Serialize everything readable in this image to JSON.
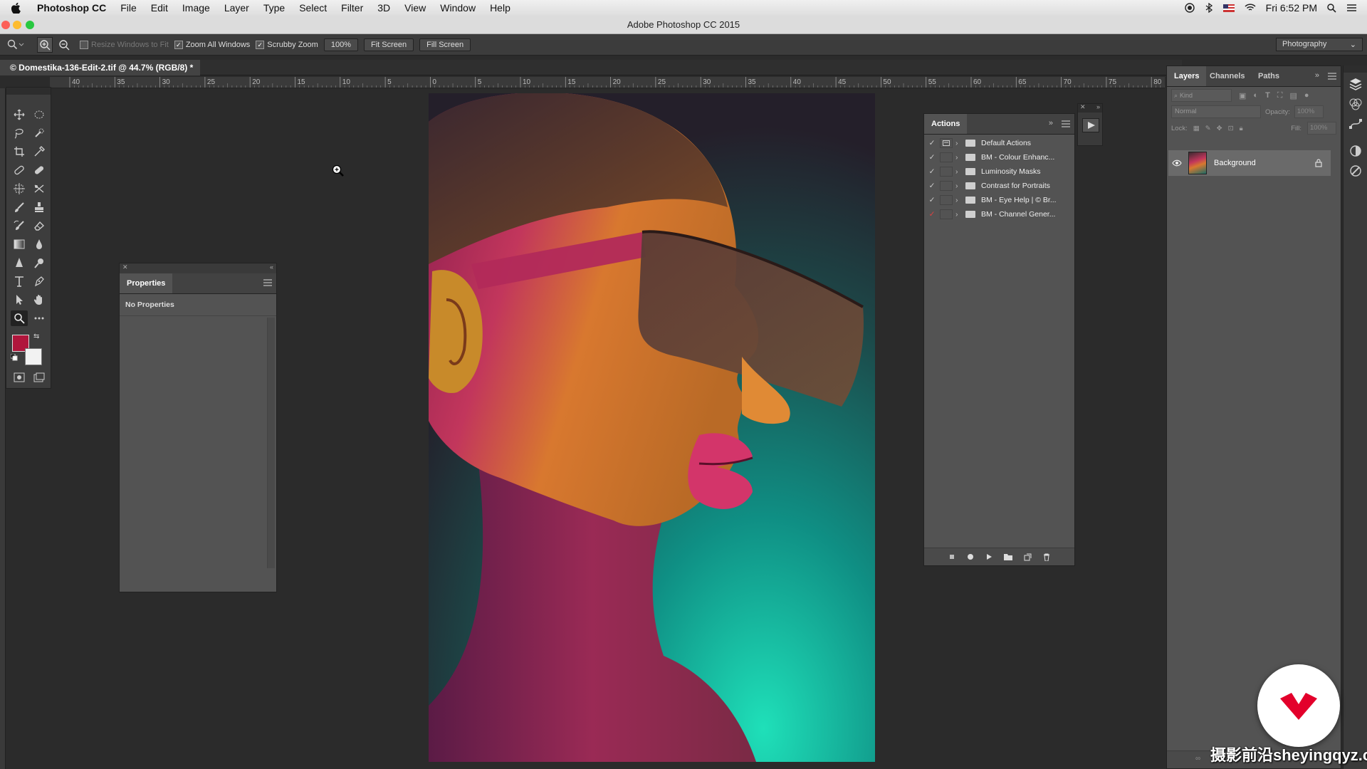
{
  "menubar": {
    "app_name": "Photoshop CC",
    "items": [
      "File",
      "Edit",
      "Image",
      "Layer",
      "Type",
      "Select",
      "Filter",
      "3D",
      "View",
      "Window",
      "Help"
    ],
    "clock": "Fri 6:52 PM"
  },
  "window": {
    "title": "Adobe Photoshop CC 2015"
  },
  "options_bar": {
    "resize_windows_label": "Resize Windows to Fit",
    "zoom_all_label": "Zoom All Windows",
    "scrubby_zoom_label": "Scrubby Zoom",
    "zoom_100_label": "100%",
    "fit_screen_label": "Fit Screen",
    "fill_screen_label": "Fill Screen",
    "workspace": "Photography"
  },
  "document": {
    "tab_title": "© Domestika-136-Edit-2.tif @ 44.7% (RGB/8) *"
  },
  "ruler": {
    "labels": [
      "40",
      "35",
      "30",
      "25",
      "20",
      "15",
      "10",
      "5",
      "0",
      "5",
      "10",
      "15",
      "20",
      "25",
      "30",
      "35",
      "40",
      "45",
      "50",
      "55",
      "60",
      "65",
      "70",
      "75",
      "80"
    ]
  },
  "toolbox": {
    "tools": [
      "move-tool",
      "marquee-tool",
      "lasso-tool",
      "quick-select-tool",
      "crop-tool",
      "eyedropper-tool",
      "healing-brush-tool",
      "patch-tool",
      "content-aware-tool",
      "brush-tool",
      "clone-stamp-tool",
      "history-brush-tool",
      "eraser-tool",
      "gradient-tool",
      "blur-tool",
      "dodge-tool",
      "pen-tool",
      "type-tool",
      "path-select-tool",
      "hand-tool",
      "zoom-tool",
      "more-tools"
    ],
    "foreground_color": "#b0163c",
    "background_color": "#f2f2f2"
  },
  "properties_panel": {
    "title": "Properties",
    "message": "No Properties"
  },
  "actions_panel": {
    "title": "Actions",
    "items": [
      {
        "label": "Default Actions",
        "checked": true
      },
      {
        "label": "BM - Colour Enhanc...",
        "checked": true
      },
      {
        "label": "Luminosity Masks",
        "checked": true
      },
      {
        "label": "Contrast for Portraits",
        "checked": true
      },
      {
        "label": "BM - Eye Help | © Br...",
        "checked": true
      },
      {
        "label": "BM - Channel Gener...",
        "checked": true,
        "red_check": true
      }
    ]
  },
  "layers_panel": {
    "tabs": [
      "Layers",
      "Channels",
      "Paths"
    ],
    "filter_placeholder": "Kind",
    "blend_mode": "Normal",
    "opacity_label": "Opacity:",
    "opacity_value": "100%",
    "lock_label": "Lock:",
    "fill_label": "Fill:",
    "fill_value": "100%",
    "layers": [
      {
        "name": "Background",
        "visible": true,
        "locked": true
      }
    ]
  },
  "watermark": {
    "text": "摄影前沿sheyingqyz.com"
  },
  "colors": {
    "panel_bg": "#535353",
    "workspace_bg": "#2b2b2b",
    "domestika_red": "#e3002b"
  }
}
